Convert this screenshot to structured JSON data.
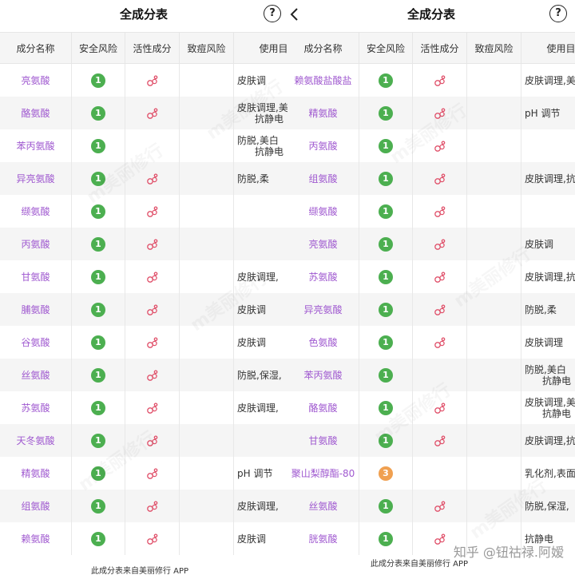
{
  "left": {
    "title": "全成分表",
    "headers": [
      "成分名称",
      "安全风险",
      "活性成分",
      "致痘风险",
      "使用目"
    ],
    "rows": [
      {
        "name": "亮氨酸",
        "risk": "1",
        "active": true,
        "use": [
          "皮肤调"
        ]
      },
      {
        "name": "酪氨酸",
        "risk": "1",
        "active": true,
        "use": [
          "皮肤调理,美",
          "抗静电"
        ]
      },
      {
        "name": "苯丙氨酸",
        "risk": "1",
        "active": false,
        "use": [
          "防脱,美白",
          "抗静电"
        ]
      },
      {
        "name": "异亮氨酸",
        "risk": "1",
        "active": true,
        "use": [
          "防脱,柔"
        ]
      },
      {
        "name": "缬氨酸",
        "risk": "1",
        "active": true,
        "use": [
          ""
        ]
      },
      {
        "name": "丙氨酸",
        "risk": "1",
        "active": true,
        "use": [
          ""
        ]
      },
      {
        "name": "甘氨酸",
        "risk": "1",
        "active": true,
        "use": [
          "皮肤调理,"
        ]
      },
      {
        "name": "脯氨酸",
        "risk": "1",
        "active": true,
        "use": [
          "皮肤调"
        ]
      },
      {
        "name": "谷氨酸",
        "risk": "1",
        "active": true,
        "use": [
          "皮肤调"
        ]
      },
      {
        "name": "丝氨酸",
        "risk": "1",
        "active": true,
        "use": [
          "防脱,保湿,"
        ]
      },
      {
        "name": "苏氨酸",
        "risk": "1",
        "active": true,
        "use": [
          "皮肤调理,"
        ]
      },
      {
        "name": "天冬氨酸",
        "risk": "1",
        "active": true,
        "use": [
          ""
        ]
      },
      {
        "name": "精氨酸",
        "risk": "1",
        "active": true,
        "use": [
          "pH 调节"
        ]
      },
      {
        "name": "组氨酸",
        "risk": "1",
        "active": true,
        "use": [
          "皮肤调理,"
        ]
      },
      {
        "name": "赖氨酸",
        "risk": "1",
        "active": true,
        "use": [
          "皮肤调"
        ]
      }
    ],
    "footer": "此成分表来自美丽修行 APP"
  },
  "right": {
    "title": "全成分表",
    "headers": [
      "成分名称",
      "安全风险",
      "活性成分",
      "致痘风险",
      "使用目"
    ],
    "rows": [
      {
        "name": "赖氨酸盐酸盐",
        "risk": "1",
        "active": true,
        "use": [
          "皮肤调理,美"
        ]
      },
      {
        "name": "精氨酸",
        "risk": "1",
        "active": true,
        "use": [
          "pH 调节"
        ]
      },
      {
        "name": "丙氨酸",
        "risk": "1",
        "active": true,
        "use": [
          ""
        ]
      },
      {
        "name": "组氨酸",
        "risk": "1",
        "active": true,
        "use": [
          "皮肤调理,抗"
        ]
      },
      {
        "name": "缬氨酸",
        "risk": "1",
        "active": true,
        "use": [
          ""
        ]
      },
      {
        "name": "亮氨酸",
        "risk": "1",
        "active": true,
        "use": [
          "皮肤调"
        ]
      },
      {
        "name": "苏氨酸",
        "risk": "1",
        "active": true,
        "use": [
          "皮肤调理,抗"
        ]
      },
      {
        "name": "异亮氨酸",
        "risk": "1",
        "active": true,
        "use": [
          "防脱,柔"
        ]
      },
      {
        "name": "色氨酸",
        "risk": "1",
        "active": true,
        "use": [
          "皮肤调理"
        ]
      },
      {
        "name": "苯丙氨酸",
        "risk": "1",
        "active": false,
        "use": [
          "防脱,美白",
          "抗静电"
        ]
      },
      {
        "name": "酪氨酸",
        "risk": "1",
        "active": true,
        "use": [
          "皮肤调理,美",
          "抗静电"
        ]
      },
      {
        "name": "甘氨酸",
        "risk": "1",
        "active": true,
        "use": [
          "皮肤调理,抗"
        ]
      },
      {
        "name": "聚山梨醇酯-80",
        "risk": "3",
        "active": false,
        "use": [
          "乳化剂,表面"
        ]
      },
      {
        "name": "丝氨酸",
        "risk": "1",
        "active": true,
        "use": [
          "防脱,保湿,"
        ]
      },
      {
        "name": "胱氨酸",
        "risk": "1",
        "active": true,
        "use": [
          "抗静电"
        ]
      }
    ],
    "footer": "此成分表来自美丽修行 APP"
  },
  "watermark_text": "m美丽修行",
  "credit": "知乎 @钮祜禄.阿嫒",
  "colors": {
    "risk_low": "#4caf50",
    "risk_mid": "#f0a050",
    "name": "#a05ad0",
    "icon": "#e0506a"
  }
}
